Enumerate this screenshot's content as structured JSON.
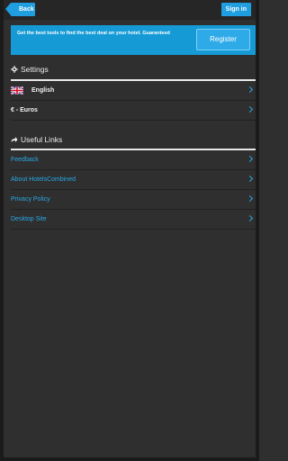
{
  "header": {
    "back_label": "Back",
    "signin_label": "Sign in"
  },
  "promo": {
    "text": "Get the best tools to find the best deal on your hotel. Guaranteed",
    "register_label": "Register"
  },
  "settings": {
    "title": "Settings",
    "icon": "gear-icon",
    "items": [
      {
        "label": "English",
        "icon": "uk-flag-icon"
      },
      {
        "label": "€ - Euros"
      }
    ]
  },
  "links": {
    "title": "Useful Links",
    "icon": "share-icon",
    "items": [
      {
        "label": "Feedback"
      },
      {
        "label": "About HotelsCombined"
      },
      {
        "label": "Privacy Policy"
      },
      {
        "label": "Desktop Site"
      }
    ]
  },
  "colors": {
    "accent": "#1f9ee0",
    "link": "#29a8e6",
    "background": "#2f2f2f"
  }
}
